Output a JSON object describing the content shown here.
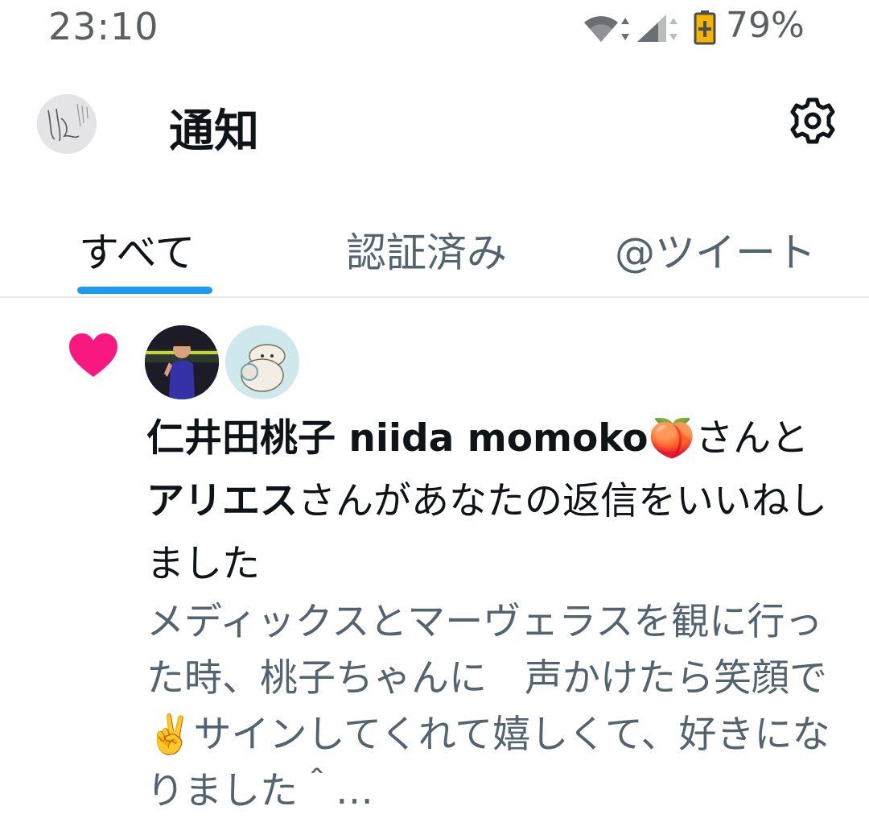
{
  "status_bar": {
    "time": "23:10",
    "battery_percent": "79%",
    "icons": [
      "wifi-icon",
      "cellular-signal-icon",
      "battery-charging-icon"
    ]
  },
  "header": {
    "title": "通知",
    "avatar": "profile-avatar",
    "settings_icon": "gear-icon"
  },
  "tabs": [
    {
      "label": "すべて",
      "selected": true
    },
    {
      "label": "認証済み",
      "selected": false
    },
    {
      "label": "@ツイート",
      "selected": false
    }
  ],
  "notification": {
    "type_icon": "heart-icon",
    "user1_name": "仁井田桃子 niida momoko🍑",
    "conj1": "さん",
    "conj2": "と",
    "user2_name": "アリエス",
    "action": "さんがあなたの返信をいいねしました",
    "tweet_text": "メディックスとマーヴェラスを観に行った時、桃子ちゃんに　声かけたら笑顔で✌️サインしてくれて嬉しくて、好きになりました＾…"
  },
  "colors": {
    "accent": "#1d9bf0",
    "heart": "#f91880",
    "secondary_text": "#536471"
  }
}
